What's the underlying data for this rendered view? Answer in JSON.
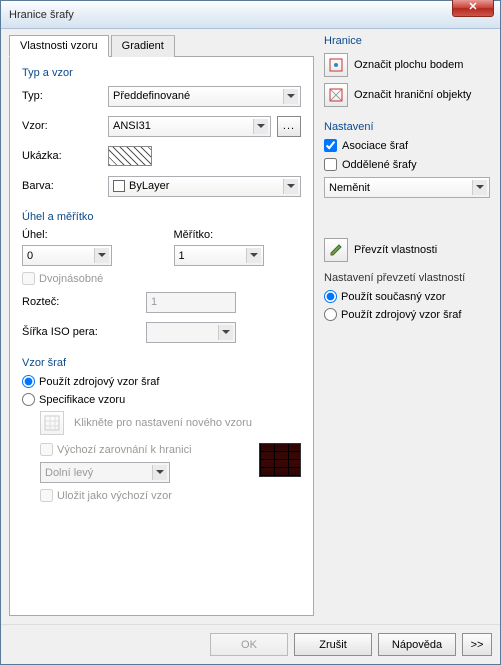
{
  "window": {
    "title": "Hranice šrafy"
  },
  "tabs": {
    "pattern": "Vlastnosti vzoru",
    "gradient": "Gradient"
  },
  "groups": {
    "typeAndPattern": "Typ a vzor",
    "angleAndScale": "Úhel a měřítko",
    "hatchPattern": "Vzor šraf"
  },
  "labels": {
    "type": "Typ:",
    "pattern": "Vzor:",
    "sample": "Ukázka:",
    "color": "Barva:",
    "angle": "Úhel:",
    "scale": "Měřítko:",
    "double": "Dvojnásobné",
    "spacing": "Rozteč:",
    "isoPen": "Šířka ISO pera:",
    "useSource": "Použít zdrojový vzor šraf",
    "specPattern": "Specifikace vzoru",
    "clickForPattern": "Klikněte pro nastavení nového vzoru",
    "defaultAlign": "Výchozí zarovnání k hranici",
    "alignValue": "Dolní levý",
    "saveDefault": "Uložit jako výchozí vzor"
  },
  "values": {
    "type": "Předdefinované",
    "pattern": "ANSI31",
    "color": "ByLayer",
    "angle": "0",
    "scale": "1",
    "spacing": "1"
  },
  "right": {
    "boundary": "Hranice",
    "pickPoint": "Označit plochu bodem",
    "selectObjects": "Označit hraniční objekty",
    "settings": "Nastavení",
    "assoc": "Asociace šraf",
    "separate": "Oddělené šrafy",
    "dontChange": "Neměnit",
    "inherit": "Převzít vlastnosti",
    "inheritSettings": "Nastavení převzetí vlastností",
    "useCurrent": "Použít současný vzor",
    "useSourceHatch": "Použít zdrojový vzor šraf"
  },
  "buttons": {
    "ok": "OK",
    "cancel": "Zrušit",
    "help": "Nápověda",
    "more": ">>",
    "browse": "..."
  }
}
